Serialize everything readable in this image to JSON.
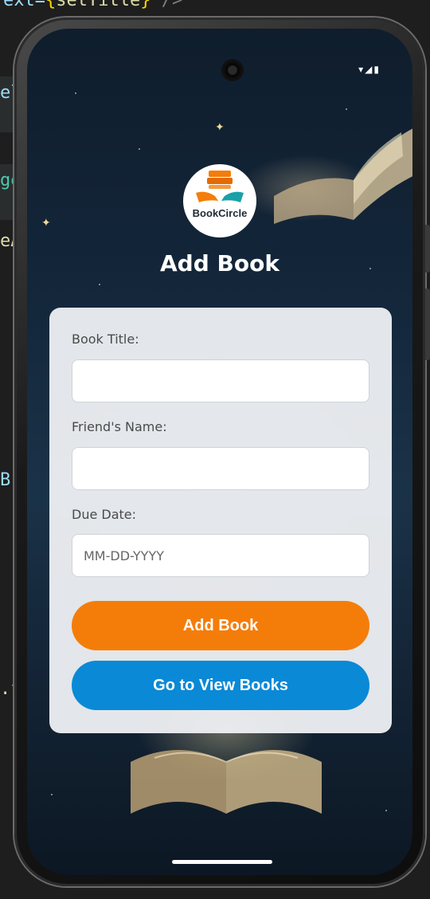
{
  "editor": {
    "line_top_prefix": "ext=",
    "line_top_brace_open": "{",
    "line_top_fn": "setTitle",
    "line_top_brace_close": "}",
    "line_top_tag": " />",
    "line_el": "el",
    "line_ge": "ge",
    "line_ea": "eA",
    "line_be": "B",
    "line_dot": ".f"
  },
  "app": {
    "logo_text": "BookCircle",
    "page_title": "Add Book"
  },
  "form": {
    "book_title_label": "Book Title:",
    "book_title_value": "",
    "friend_name_label": "Friend's Name:",
    "friend_name_value": "",
    "due_date_label": "Due Date:",
    "due_date_value": "",
    "due_date_placeholder": "MM-DD-YYYY"
  },
  "buttons": {
    "add_book": "Add Book",
    "view_books": "Go to View Books"
  },
  "colors": {
    "accent_orange": "#f47d0a",
    "accent_blue": "#0a89d6",
    "logo_teal": "#1aa0a8"
  },
  "icons": {
    "logo": "book-hands-icon",
    "camera": "front-camera",
    "status": [
      "signal-icon",
      "battery-icon"
    ]
  }
}
